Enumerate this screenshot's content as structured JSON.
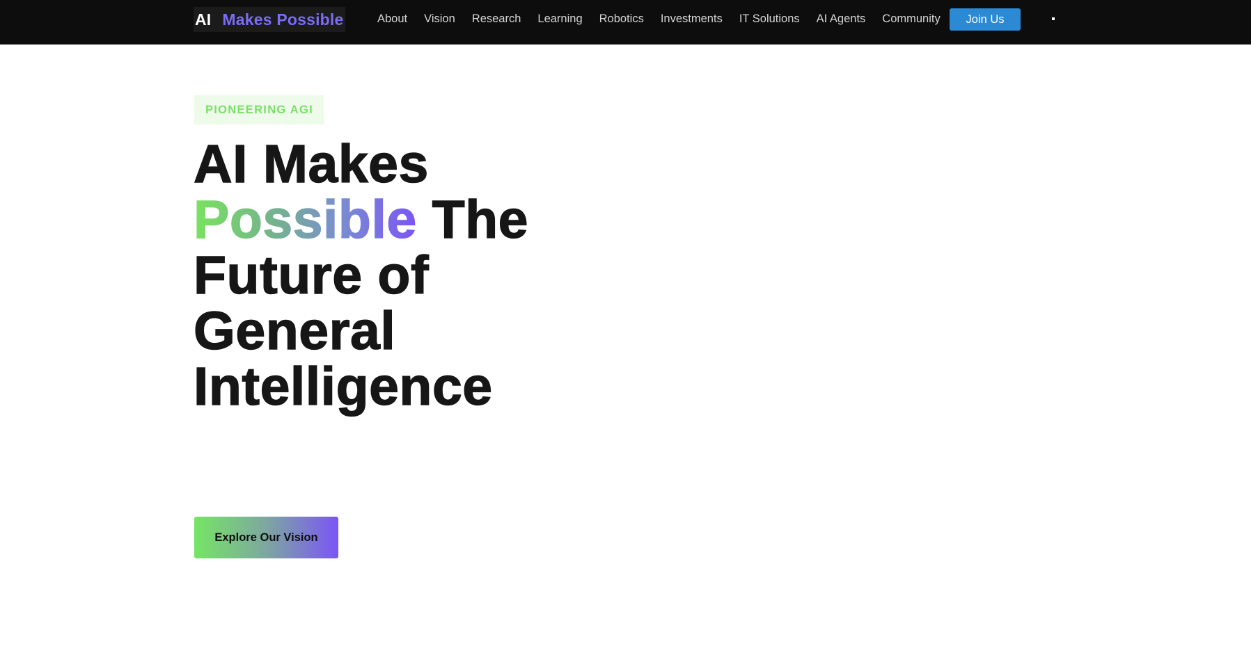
{
  "header": {
    "logo_prefix": "AI",
    "logo_highlight": "Makes Possible",
    "nav_links": [
      "About",
      "Vision",
      "Research",
      "Learning",
      "Robotics",
      "Investments",
      "IT Solutions",
      "AI Agents",
      "Community"
    ],
    "join_label": "Join Us"
  },
  "hero": {
    "badge": "PIONEERING AGI",
    "title_line1": "AI Makes",
    "title_gradient_word": "Possible",
    "title_line2_rest": "The",
    "title_line3": "Future of",
    "title_line4": "General",
    "title_line5": "Intelligence",
    "cta_label": "Explore Our Vision"
  },
  "colors": {
    "nav_background": "#0d0d0d",
    "logo_accent": "#7a6cf5",
    "join_button": "#2b8ad3",
    "badge_text": "#7be068",
    "badge_background": "#eefbea",
    "gradient_start": "#79e35f",
    "gradient_end": "#7b55f6",
    "heading_text": "#161616"
  },
  "icons": {
    "menu": "menu-dot-icon"
  }
}
